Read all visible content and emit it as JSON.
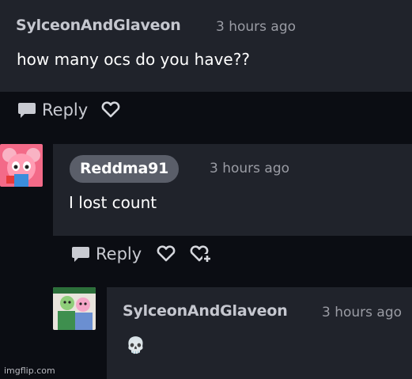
{
  "comments": [
    {
      "username": "SylceonAndGlaveon",
      "timestamp": "3 hours ago",
      "text": "how many ocs do you have??"
    },
    {
      "username": "Reddma91",
      "timestamp": "3 hours ago",
      "text": "I lost count"
    },
    {
      "username": "SylceonAndGlaveon",
      "timestamp": "3 hours ago",
      "text": "💀"
    }
  ],
  "actions": {
    "reply_label": "Reply",
    "reply_icon": "speech-bubble-icon",
    "like_icon": "heart-icon",
    "add_like_icon": "heart-plus-icon"
  },
  "watermark": "imgflip.com",
  "colors": {
    "background": "#0b0d13",
    "card": "#20232b",
    "username_pill": "#5a5e69",
    "muted_text": "#9a9ca4"
  }
}
